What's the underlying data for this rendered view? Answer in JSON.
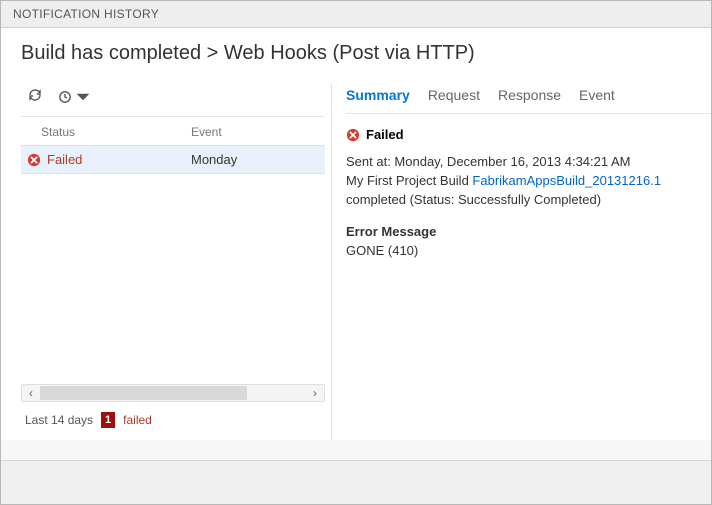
{
  "topbar": {
    "title": "NOTIFICATION HISTORY"
  },
  "page": {
    "title": "Build has completed > Web Hooks (Post via HTTP)"
  },
  "grid": {
    "headers": {
      "status": "Status",
      "event": "Event"
    },
    "rows": [
      {
        "status": "Failed",
        "event": "Monday"
      }
    ]
  },
  "footer": {
    "range": "Last 14 days",
    "badge": "1",
    "label": "failed"
  },
  "tabs": {
    "summary": "Summary",
    "request": "Request",
    "response": "Response",
    "event": "Event"
  },
  "detail": {
    "status": "Failed",
    "sent_prefix": "Sent at: ",
    "sent_at": "Monday, December 16, 2013 4:34:21 AM",
    "line2_a": "My First Project Build ",
    "line2_link": "FabrikamAppsBuild_20131216.1",
    "line2_b": " completed (Status: Successfully Completed)",
    "error_head": "Error Message",
    "error_body": "GONE (410)"
  }
}
